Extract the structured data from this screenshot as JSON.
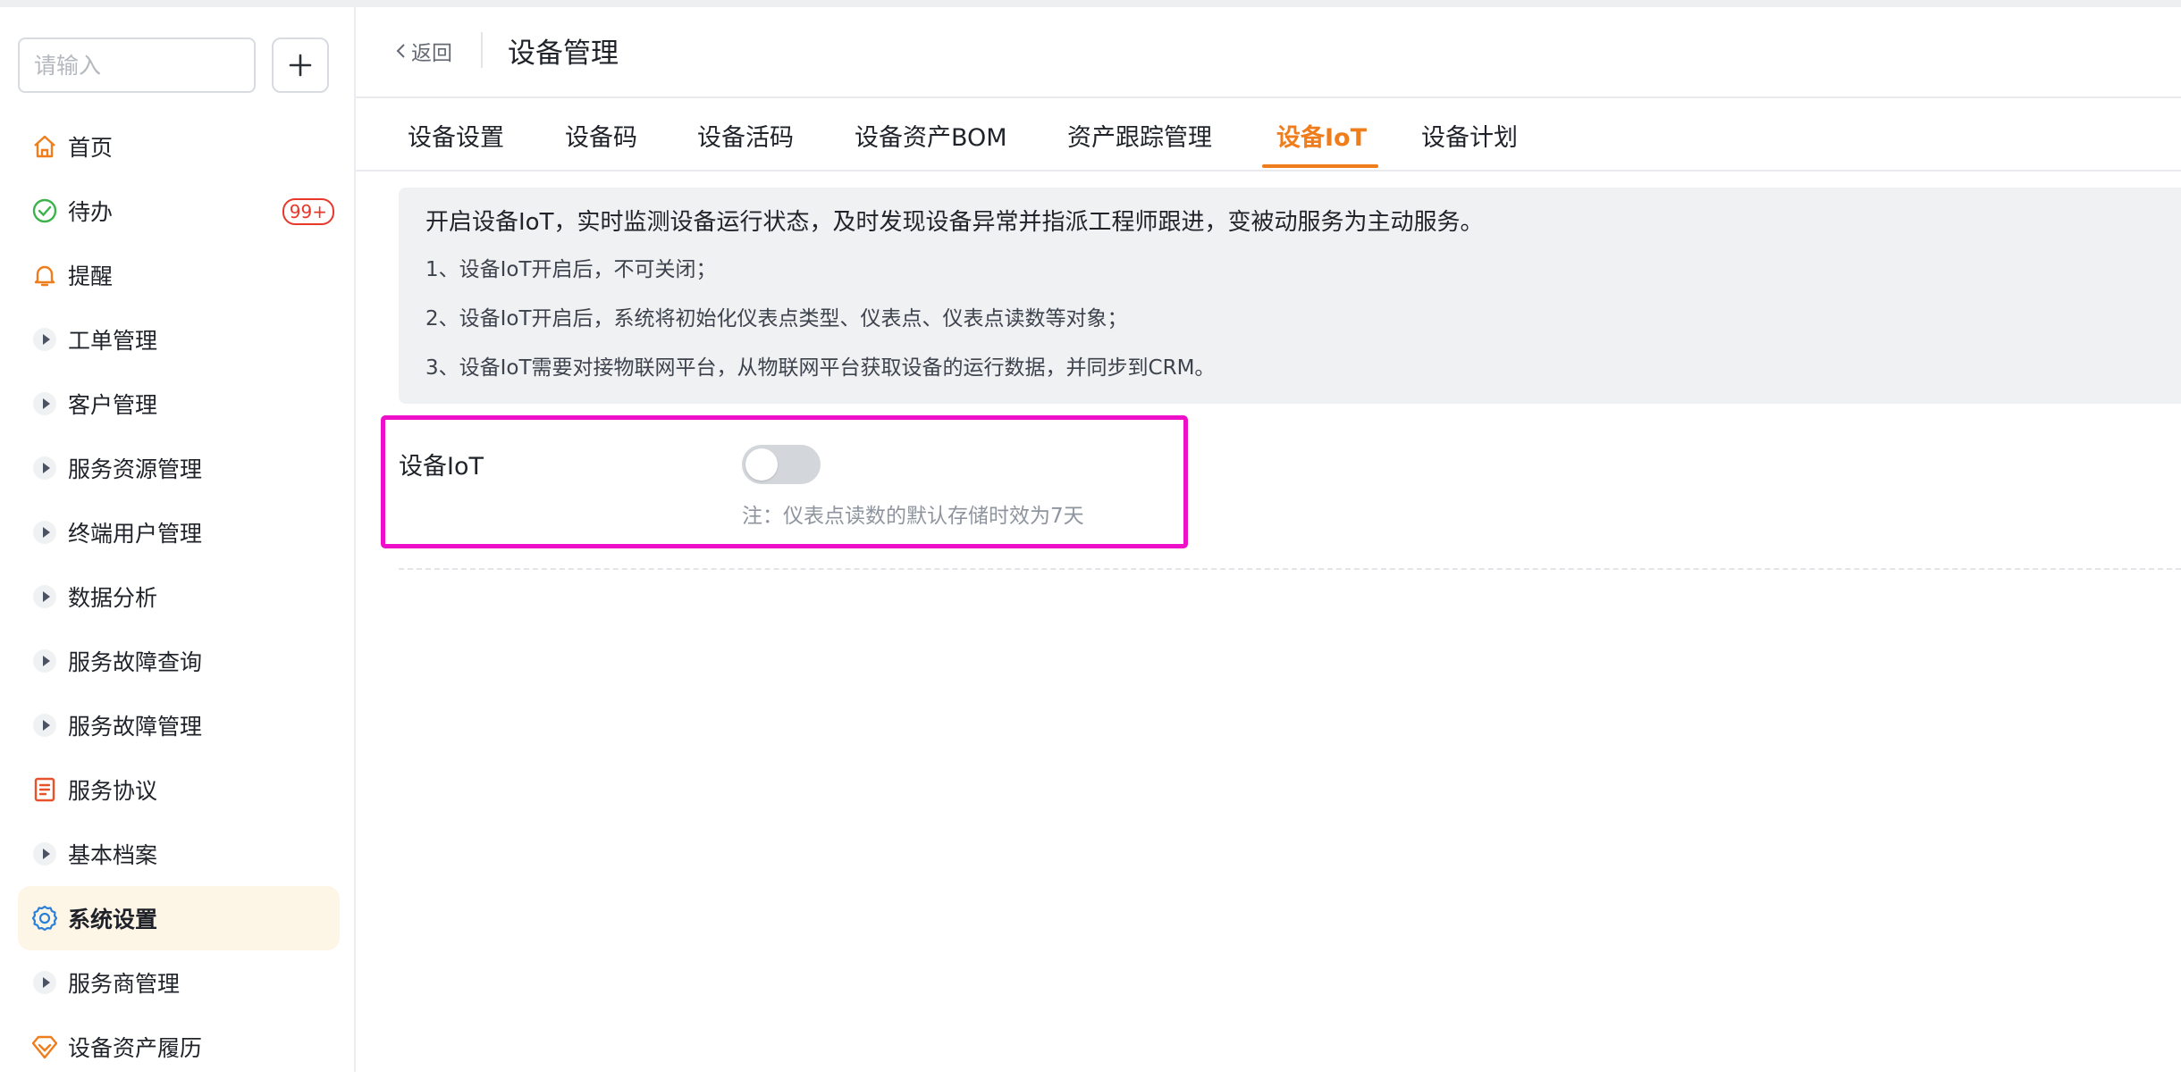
{
  "search": {
    "placeholder": "请输入"
  },
  "sidebar": {
    "items": [
      {
        "label": "首页",
        "icon": "home-icon"
      },
      {
        "label": "待办",
        "icon": "check-circle-icon",
        "badge": "99+"
      },
      {
        "label": "提醒",
        "icon": "bell-icon"
      },
      {
        "label": "工单管理",
        "icon": "caret-right-icon"
      },
      {
        "label": "客户管理",
        "icon": "caret-right-icon"
      },
      {
        "label": "服务资源管理",
        "icon": "caret-right-icon"
      },
      {
        "label": "终端用户管理",
        "icon": "caret-right-icon"
      },
      {
        "label": "数据分析",
        "icon": "caret-right-icon"
      },
      {
        "label": "服务故障查询",
        "icon": "caret-right-icon"
      },
      {
        "label": "服务故障管理",
        "icon": "caret-right-icon"
      },
      {
        "label": "服务协议",
        "icon": "contract-icon"
      },
      {
        "label": "基本档案",
        "icon": "caret-right-icon"
      },
      {
        "label": "系统设置",
        "icon": "gear-icon",
        "active": true
      },
      {
        "label": "服务商管理",
        "icon": "caret-right-icon"
      },
      {
        "label": "设备资产履历",
        "icon": "diamond-icon"
      }
    ]
  },
  "header": {
    "back_label": "返回",
    "title": "设备管理"
  },
  "tabs": [
    {
      "label": "设备设置"
    },
    {
      "label": "设备码"
    },
    {
      "label": "设备活码"
    },
    {
      "label": "设备资产BOM"
    },
    {
      "label": "资产跟踪管理"
    },
    {
      "label": "设备IoT",
      "active": true
    },
    {
      "label": "设备计划"
    }
  ],
  "notice": {
    "main": "开启设备IoT，实时监测设备运行状态，及时发现设备异常并指派工程师跟进，变被动服务为主动服务。",
    "items": [
      "1、设备IoT开启后，不可关闭；",
      "2、设备IoT开启后，系统将初始化仪表点类型、仪表点、仪表点读数等对象；",
      "3、设备IoT需要对接物联网平台，从物联网平台获取设备的运行数据，并同步到CRM。"
    ]
  },
  "iot_setting": {
    "label": "设备IoT",
    "enabled": false,
    "note": "注：仪表点读数的默认存储时效为7天"
  },
  "colors": {
    "accent": "#f07d1c",
    "badge": "#e8382a",
    "highlight": "#ee10c8",
    "active_bg": "#fdf5e6"
  }
}
